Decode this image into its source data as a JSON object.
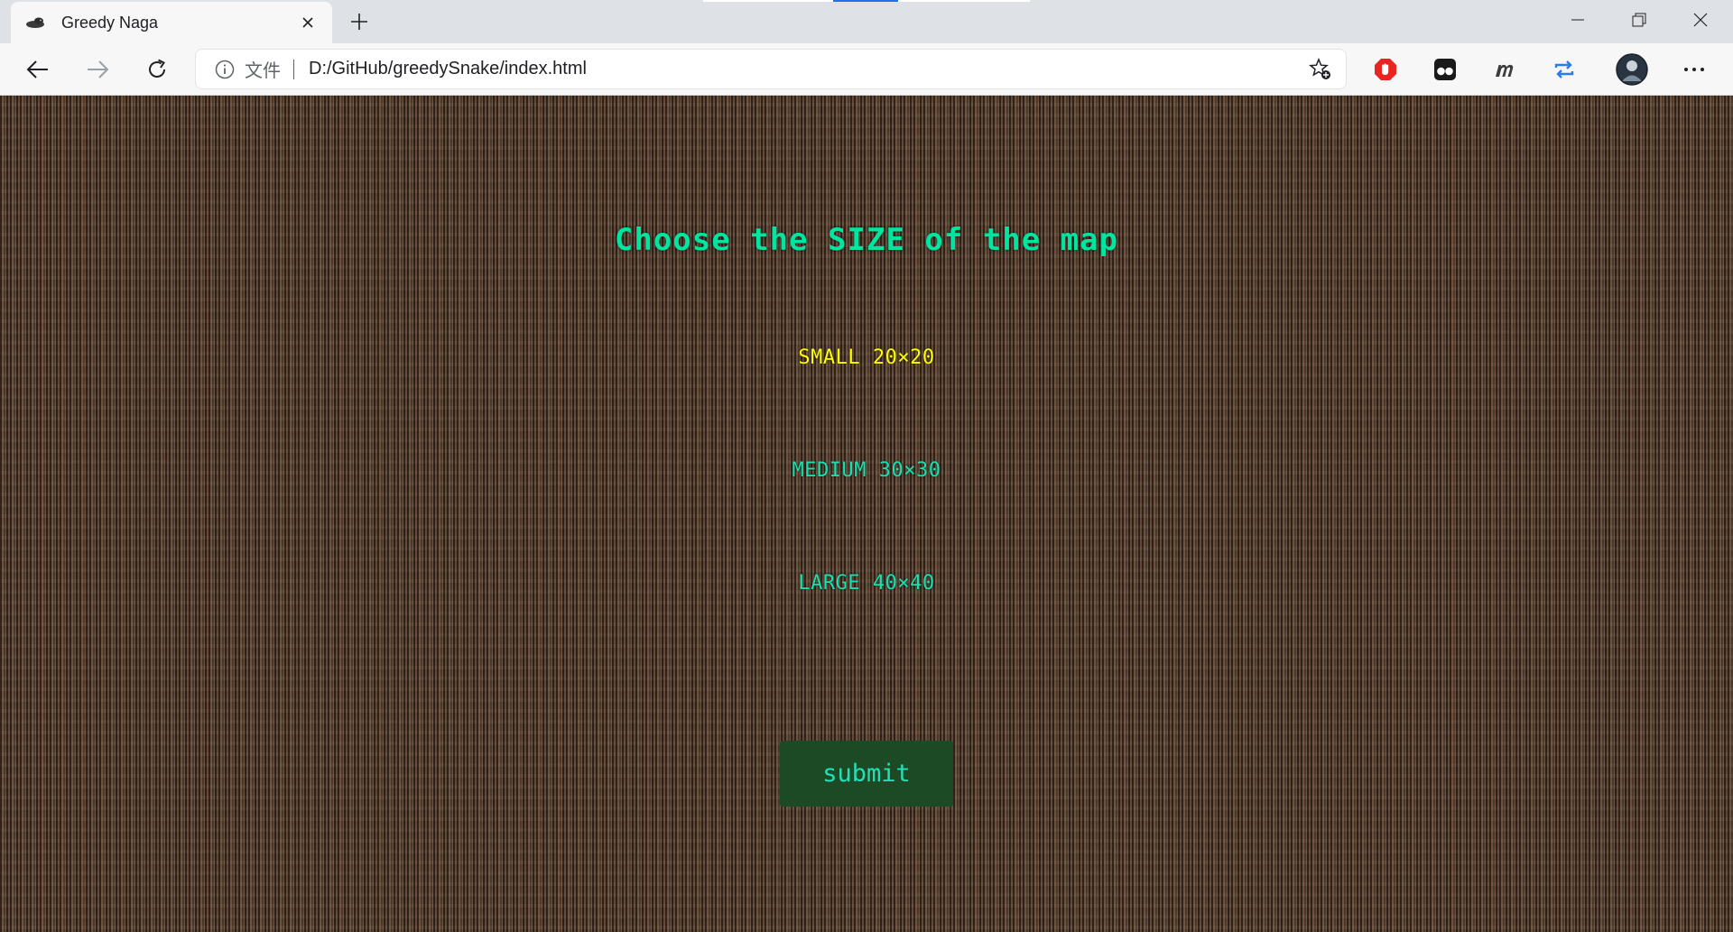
{
  "browser": {
    "tab": {
      "title": "Greedy Naga"
    },
    "address": {
      "scheme_label": "文件",
      "url": "D:/GitHub/greedySnake/index.html"
    }
  },
  "page": {
    "heading": "Choose the SIZE of the map",
    "options": [
      {
        "label": "SMALL 20×20",
        "selected": true
      },
      {
        "label": "MEDIUM 30×30",
        "selected": false
      },
      {
        "label": "LARGE 40×40",
        "selected": false
      }
    ],
    "submit_label": "submit"
  },
  "colors": {
    "heading": "#00e6a0",
    "option": "#19e0b0",
    "option_selected": "#ffff00",
    "button_bg": "#1c4a25",
    "button_text": "#23e0b8"
  },
  "icons": [
    "snake-favicon-icon",
    "close-icon",
    "plus-icon",
    "minimize-icon",
    "restore-icon",
    "window-close-icon",
    "back-icon",
    "forward-icon",
    "refresh-icon",
    "info-icon",
    "add-favorite-icon",
    "adblock-icon",
    "tampermonkey-icon",
    "m-extension-icon",
    "sync-icon",
    "profile-avatar-icon",
    "more-icon"
  ]
}
